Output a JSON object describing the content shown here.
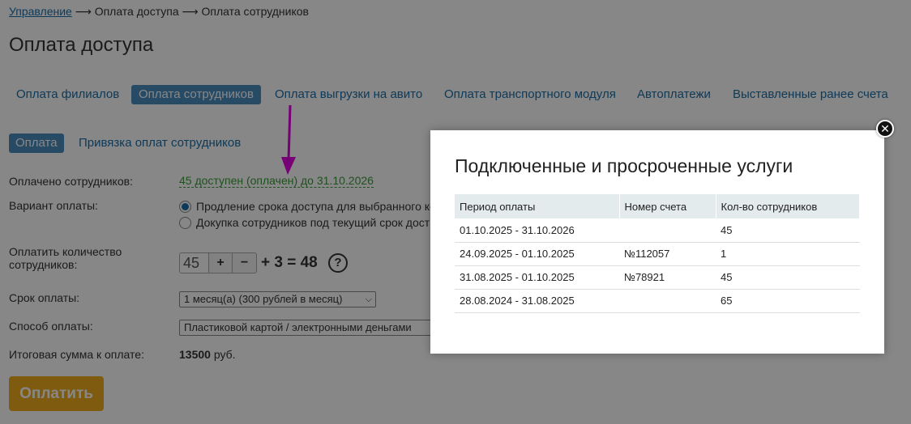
{
  "breadcrumb": {
    "root": "Управление",
    "sep": " ⟶ ",
    "level2": "Оплата доступа",
    "level3": "Оплата сотрудников"
  },
  "page_title": "Оплата доступа",
  "tabs": [
    {
      "label": "Оплата филиалов",
      "active": false
    },
    {
      "label": "Оплата сотрудников",
      "active": true
    },
    {
      "label": "Оплата выгрузки на авито",
      "active": false
    },
    {
      "label": "Оплата транспортного модуля",
      "active": false
    },
    {
      "label": "Автоплатежи",
      "active": false
    },
    {
      "label": "Выставленные ранее счета",
      "active": false
    }
  ],
  "subtabs": [
    {
      "label": "Оплата",
      "active": true
    },
    {
      "label": "Привязка оплат сотрудников",
      "active": false
    }
  ],
  "form": {
    "paid_label": "Оплачено сотрудников:",
    "paid_value": "45 доступен (оплачен) до 31.10.2026",
    "variant_label": "Вариант оплаты:",
    "variant_options": [
      {
        "label": "Продление срока доступа для выбранного ко",
        "checked": true
      },
      {
        "label": "Докупка сотрудников под текущий срок дост",
        "checked": false
      }
    ],
    "qty_label_line1": "Оплатить количество",
    "qty_label_line2": "сотрудников:",
    "qty_value": "45",
    "qty_plus": "+",
    "qty_minus": "−",
    "qty_formula": "+ 3 = 48",
    "help_symbol": "?",
    "term_label": "Срок оплаты:",
    "term_value": "1 месяц(а) (300 рублей в месяц)",
    "method_label": "Способ оплаты:",
    "method_value": "Пластиковой картой / электронными деньгами",
    "total_label": "Итоговая сумма к оплате:",
    "total_amount": "13500",
    "total_currency": " руб.",
    "pay_button": "Оплатить"
  },
  "modal": {
    "title": "Подключенные и просроченные услуги",
    "columns": [
      "Период оплаты",
      "Номер счета",
      "Кол-во сотрудников"
    ],
    "rows": [
      [
        "01.10.2025 - 31.10.2026",
        "",
        "45"
      ],
      [
        "24.09.2025 - 01.10.2025",
        "№112057",
        "1"
      ],
      [
        "31.08.2025 - 01.10.2025",
        "№78921",
        "45"
      ],
      [
        "28.08.2024 - 31.08.2025",
        "",
        "65"
      ]
    ],
    "close_symbol": "✕"
  },
  "colors": {
    "link": "#1b6fa8",
    "active_tab": "#4a8cbf",
    "paid_green": "#3a9a3a",
    "pay_button": "#f0ad1e",
    "annotation_arrow": "#e000e0",
    "table_header": "#e3ebec"
  }
}
